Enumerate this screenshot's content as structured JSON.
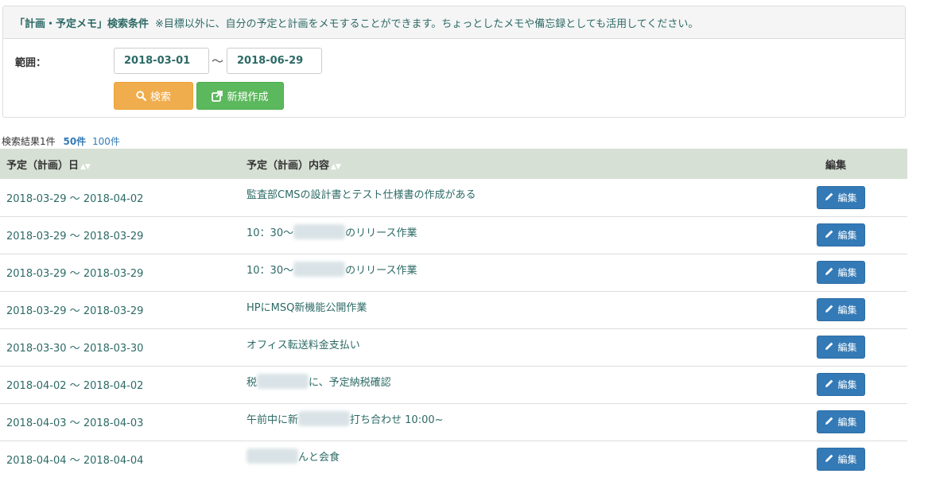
{
  "search_panel": {
    "title": "「計画・予定メモ」検索条件",
    "note": "※目標以外に、自分の予定と計画をメモすることができます。ちょっとしたメモや備忘録としても活用してください。",
    "range_label": "範囲：",
    "date_from": "2018-03-01",
    "date_to": "2018-06-29",
    "tilde": "～",
    "search_button": "検索",
    "new_button": "新規作成"
  },
  "results": {
    "count_text": "検索結果1件",
    "per_page_50": "50件",
    "per_page_100": "100件",
    "per_page_active": "50件"
  },
  "table": {
    "headers": {
      "date": "予定（計画）日",
      "content": "予定（計画）内容",
      "edit": "編集"
    },
    "edit_label": "編集",
    "rows": [
      {
        "date": "2018-03-29 ～ 2018-04-02",
        "content_pre": "監査部CMSの設計書とテスト仕様書の作成がある",
        "blurred": false,
        "content_post": ""
      },
      {
        "date": "2018-03-29 ～ 2018-03-29",
        "content_pre": "10：30～",
        "blurred": true,
        "content_post": "のリリース作業"
      },
      {
        "date": "2018-03-29 ～ 2018-03-29",
        "content_pre": "10：30～",
        "blurred": true,
        "content_post": "のリリース作業"
      },
      {
        "date": "2018-03-29 ～ 2018-03-29",
        "content_pre": "HPにMSQ新機能公開作業",
        "blurred": false,
        "content_post": ""
      },
      {
        "date": "2018-03-30 ～ 2018-03-30",
        "content_pre": "オフィス転送料金支払い",
        "blurred": false,
        "content_post": ""
      },
      {
        "date": "2018-04-02 ～ 2018-04-02",
        "content_pre": "税",
        "blurred": true,
        "content_post": "に、予定納税確認"
      },
      {
        "date": "2018-04-03 ～ 2018-04-03",
        "content_pre": "午前中に新",
        "blurred": true,
        "content_post": "打ち合わせ 10:00~"
      },
      {
        "date": "2018-04-04 ～ 2018-04-04",
        "content_pre": "",
        "blurred": true,
        "content_post": "んと会食"
      }
    ]
  },
  "colors": {
    "heading_text": "#2c6a66",
    "table_header_bg": "#d6e0d4",
    "search_button": "#f0ad4e",
    "new_button": "#5cb85c",
    "edit_button": "#337ab7",
    "link": "#337ab7"
  },
  "icons": {
    "search_button": "search-icon",
    "new_button": "external-link-icon",
    "edit_button": "pencil-icon"
  }
}
